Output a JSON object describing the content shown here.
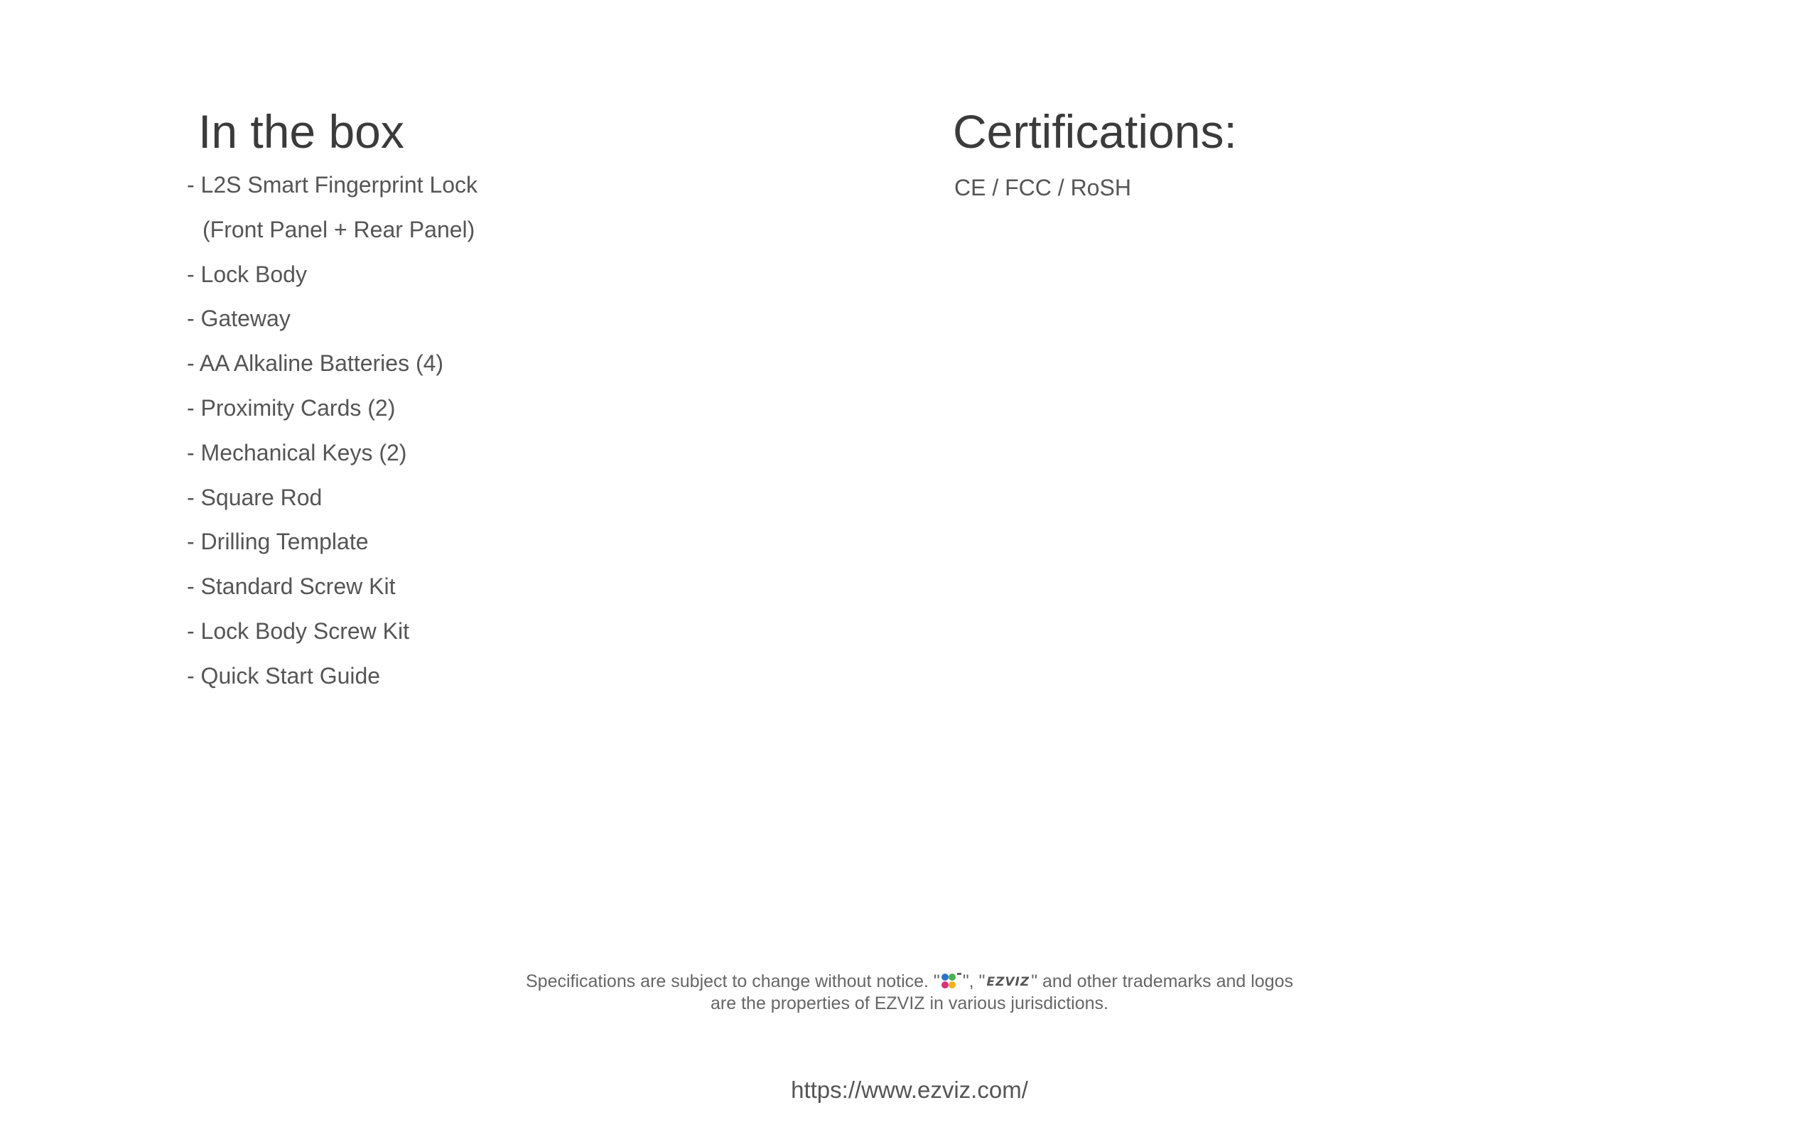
{
  "in_the_box": {
    "title": "In the box",
    "items": [
      "- L2S Smart Fingerprint Lock",
      "(Front Panel + Rear Panel)",
      "- Lock Body",
      "- Gateway",
      "- AA Alkaline Batteries (4)",
      "- Proximity Cards (2)",
      "- Mechanical Keys (2)",
      "- Square Rod",
      "- Drilling Template",
      "- Standard Screw Kit",
      "- Lock Body Screw Kit",
      "- Quick Start Guide"
    ]
  },
  "certifications": {
    "title": "Certifications:",
    "text": "CE / FCC / RoSH"
  },
  "footer": {
    "notice_start": "Specifications are subject to change without notice.  \"",
    "notice_mid": "\", \"",
    "notice_end": "\" and other trademarks and logos",
    "notice_line2": "are the properties of EZVIZ in various jurisdictions.",
    "logo_icon": "ezviz-logo-icon",
    "wordmark": "EZVIZ",
    "url": "https://www.ezviz.com/"
  }
}
